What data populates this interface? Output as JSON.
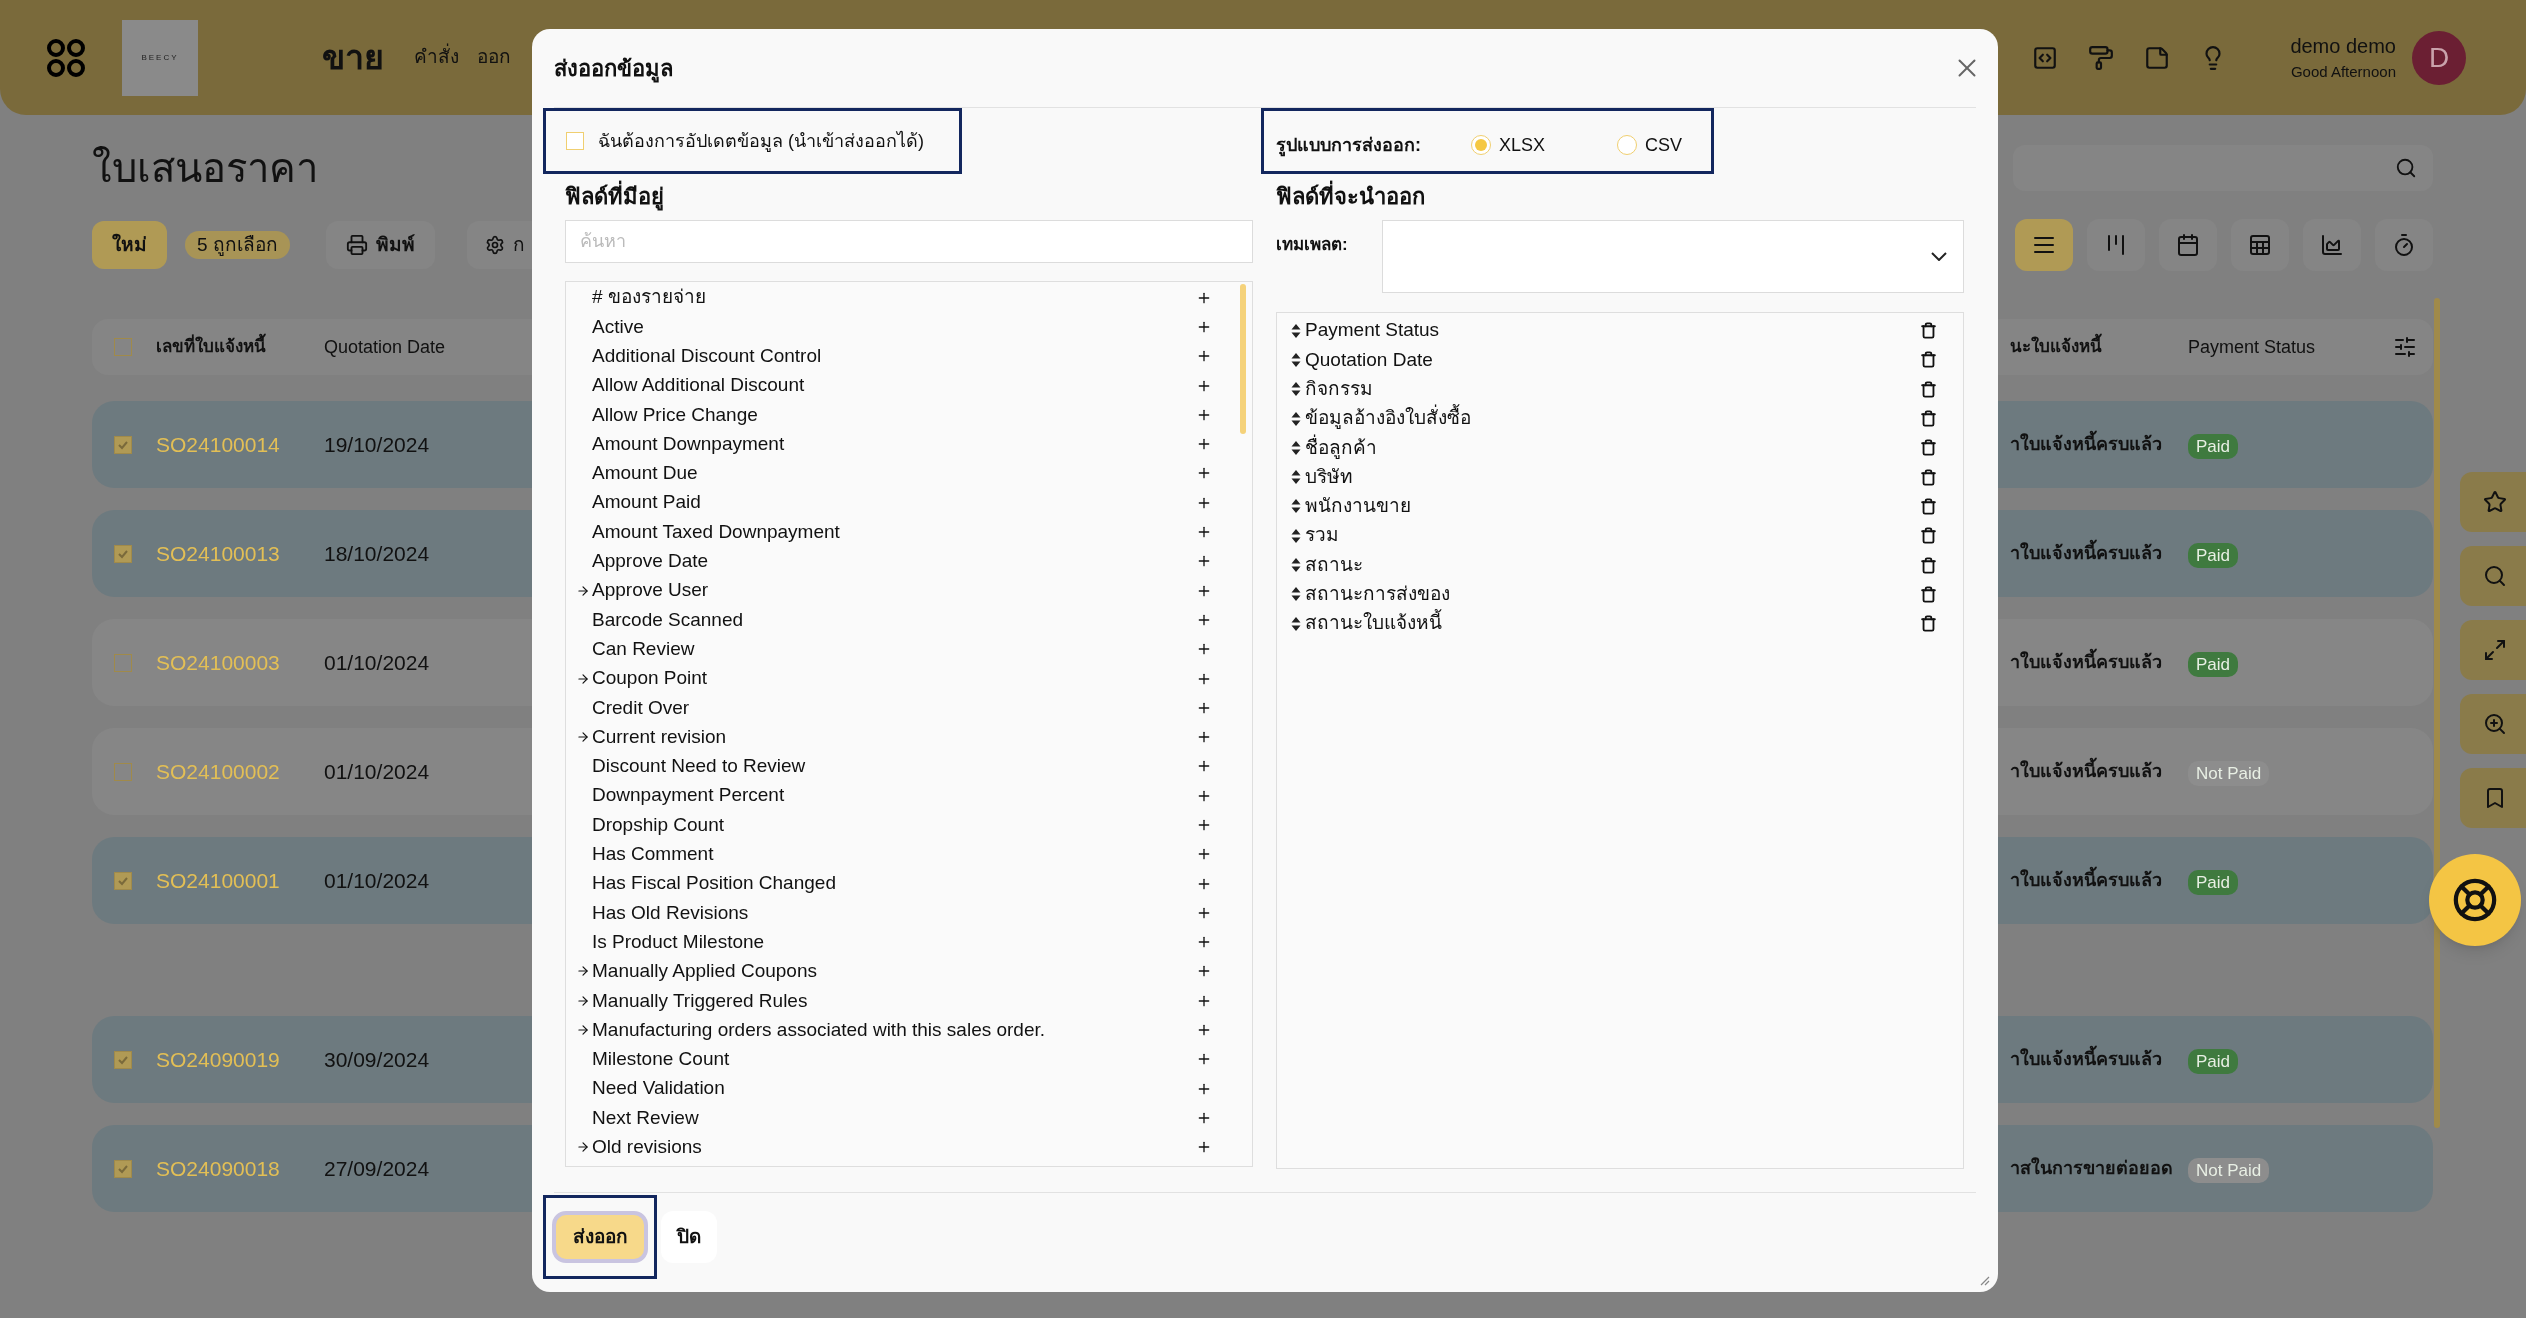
{
  "header": {
    "app_title": "ขาย",
    "logo_text": "BEECY",
    "menu": [
      "คำสั่ง",
      "ออก"
    ],
    "user": {
      "name": "demo demo",
      "greeting": "Good Afternoon",
      "initial": "D"
    }
  },
  "page": {
    "title": "ใบเสนอราคา",
    "toolbar": {
      "new_button": "ใหม่",
      "selected_count": "5 ถูกเลือก",
      "print_button": "พิมพ์",
      "settings_button": "ก"
    },
    "views": [
      {
        "kind": "list",
        "selected": true
      },
      {
        "kind": "kanban",
        "selected": false
      },
      {
        "kind": "calendar",
        "selected": false
      },
      {
        "kind": "pivot",
        "selected": false
      },
      {
        "kind": "graph",
        "selected": false
      },
      {
        "kind": "activity",
        "selected": false
      }
    ]
  },
  "table": {
    "all_checked": false,
    "columns": [
      "เลขที่ใบแจ้งหนี้",
      "Quotation Date",
      "นะใบแจ้งหนี้",
      "Payment Status"
    ],
    "groups": [
      {
        "rows": [
          {
            "checked": true,
            "number": "SO24100014",
            "date": "19/10/2024",
            "invoice_status": "าใบแจ้งหนี้ครบแล้ว",
            "payment_status": "Paid",
            "color": "#3f7a3f"
          },
          {
            "checked": true,
            "number": "SO24100013",
            "date": "18/10/2024",
            "invoice_status": "าใบแจ้งหนี้ครบแล้ว",
            "payment_status": "Paid",
            "color": "#3f7a3f"
          },
          {
            "checked": false,
            "number": "SO24100003",
            "date": "01/10/2024",
            "invoice_status": "าใบแจ้งหนี้ครบแล้ว",
            "payment_status": "Paid",
            "color": "#3f7a3f"
          },
          {
            "checked": false,
            "number": "SO24100002",
            "date": "01/10/2024",
            "invoice_status": "าใบแจ้งหนี้ครบแล้ว",
            "payment_status": "Not Paid",
            "color": "#8d8d8d"
          },
          {
            "checked": true,
            "number": "SO24100001",
            "date": "01/10/2024",
            "invoice_status": "าใบแจ้งหนี้ครบแล้ว",
            "payment_status": "Paid",
            "color": "#3f7a3f"
          }
        ]
      },
      {
        "rows": [
          {
            "checked": true,
            "number": "SO24090019",
            "date": "30/09/2024",
            "invoice_status": "าใบแจ้งหนี้ครบแล้ว",
            "payment_status": "Paid",
            "color": "#3f7a3f"
          },
          {
            "checked": true,
            "number": "SO24090018",
            "date": "27/09/2024",
            "invoice_status": "าสในการขายต่อยอด",
            "payment_status": "Not Paid",
            "color": "#8d8d8d"
          }
        ]
      }
    ]
  },
  "dialog": {
    "title": "ส่งออกข้อมูล",
    "update_checkbox": {
      "label": "ฉันต้องการอัปเดตข้อมูล (นำเข้าส่งออกได้)",
      "checked": false
    },
    "format": {
      "label": "รูปแบบการส่งออก:",
      "options": [
        {
          "label": "XLSX",
          "selected": true
        },
        {
          "label": "CSV",
          "selected": false
        }
      ]
    },
    "available": {
      "title": "ฟิลด์ที่มีอยู่",
      "search_placeholder": "ค้นหา",
      "fields": [
        {
          "label": "# ของรายจ่าย",
          "expandable": false
        },
        {
          "label": "Active",
          "expandable": false
        },
        {
          "label": "Additional Discount Control",
          "expandable": false
        },
        {
          "label": "Allow Additional Discount",
          "expandable": false
        },
        {
          "label": "Allow Price Change",
          "expandable": false
        },
        {
          "label": "Amount Downpayment",
          "expandable": false
        },
        {
          "label": "Amount Due",
          "expandable": false
        },
        {
          "label": "Amount Paid",
          "expandable": false
        },
        {
          "label": "Amount Taxed Downpayment",
          "expandable": false
        },
        {
          "label": "Approve Date",
          "expandable": false
        },
        {
          "label": "Approve User",
          "expandable": true
        },
        {
          "label": "Barcode Scanned",
          "expandable": false
        },
        {
          "label": "Can Review",
          "expandable": false
        },
        {
          "label": "Coupon Point",
          "expandable": true
        },
        {
          "label": "Credit Over",
          "expandable": false
        },
        {
          "label": "Current revision",
          "expandable": true
        },
        {
          "label": "Discount Need to Review",
          "expandable": false
        },
        {
          "label": "Downpayment Percent",
          "expandable": false
        },
        {
          "label": "Dropship Count",
          "expandable": false
        },
        {
          "label": "Has Comment",
          "expandable": false
        },
        {
          "label": "Has Fiscal Position Changed",
          "expandable": false
        },
        {
          "label": "Has Old Revisions",
          "expandable": false
        },
        {
          "label": "Is Product Milestone",
          "expandable": false
        },
        {
          "label": "Manually Applied Coupons",
          "expandable": true
        },
        {
          "label": "Manually Triggered Rules",
          "expandable": true
        },
        {
          "label": "Manufacturing orders associated with this sales order.",
          "expandable": true
        },
        {
          "label": "Milestone Count",
          "expandable": false
        },
        {
          "label": "Need Validation",
          "expandable": false
        },
        {
          "label": "Next Review",
          "expandable": false
        },
        {
          "label": "Old revisions",
          "expandable": true
        }
      ]
    },
    "export_fields": {
      "title": "ฟิลด์ที่จะนำออก",
      "template_label": "เทมเพลต:",
      "fields": [
        "Payment Status",
        "Quotation Date",
        "กิจกรรม",
        "ข้อมูลอ้างอิงใบสั่งซื้อ",
        "ชื่อลูกค้า",
        "บริษัท",
        "พนักงานขาย",
        "รวม",
        "สถานะ",
        "สถานะการส่งของ",
        "สถานะใบแจ้งหนี้"
      ]
    },
    "buttons": {
      "export": "ส่งออก",
      "close": "ปิด"
    }
  }
}
